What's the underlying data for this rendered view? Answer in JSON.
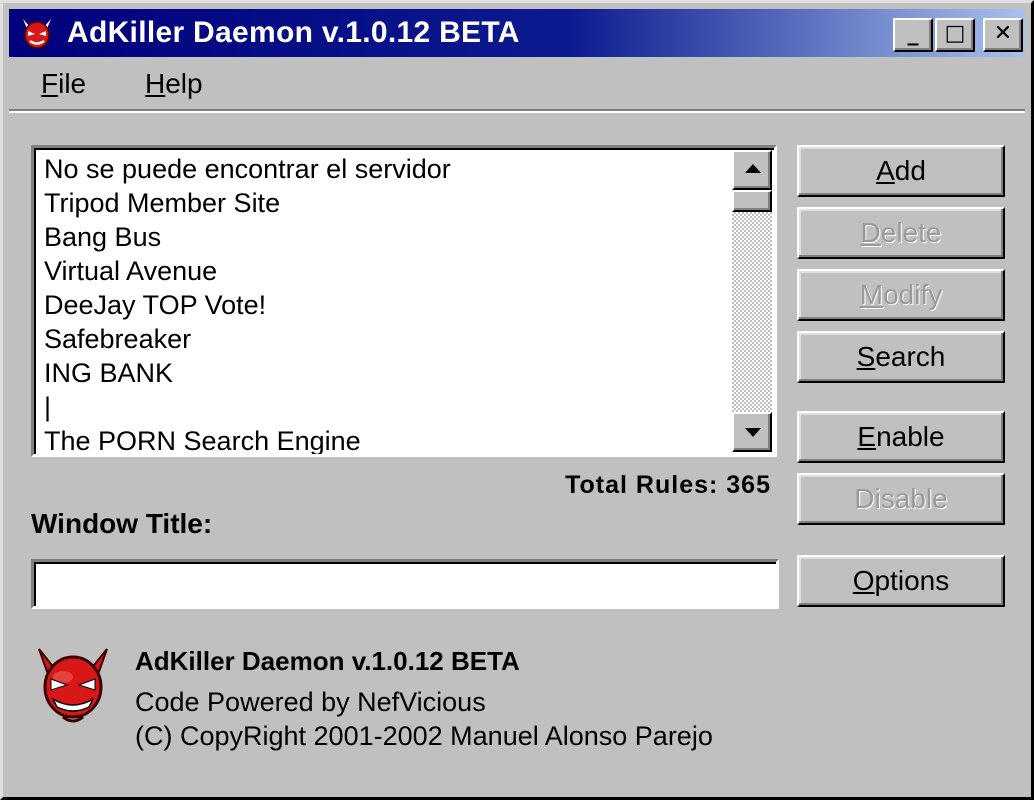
{
  "window": {
    "title": "AdKiller Daemon v.1.0.12 BETA",
    "title_gradient": [
      "#00007b",
      "#a6c2ec"
    ]
  },
  "titlebar_buttons": {
    "minimize": "_",
    "maximize": "□",
    "close": "✕"
  },
  "menu": {
    "file": {
      "accel": "F",
      "rest": "ile"
    },
    "help": {
      "accel": "H",
      "rest": "elp"
    }
  },
  "rules_list": {
    "items": [
      "No se puede encontrar el servidor",
      "Tripod Member Site",
      "Bang Bus",
      "Virtual Avenue",
      "DeeJay TOP Vote!",
      "Safebreaker",
      "ING BANK",
      "|",
      "The PORN Search Engine"
    ]
  },
  "total_rules": "Total Rules: 365",
  "window_title_label": "Window Title:",
  "window_title_value": "",
  "buttons": {
    "add": {
      "accel": "A",
      "rest": "dd",
      "enabled": true
    },
    "delete": {
      "accel": "D",
      "rest": "elete",
      "enabled": false
    },
    "modify": {
      "accel": "M",
      "rest": "odify",
      "enabled": false
    },
    "search": {
      "accel": "S",
      "rest": "earch",
      "enabled": true
    },
    "enable": {
      "accel": "E",
      "rest": "nable",
      "enabled": true
    },
    "disable_label": "Disable",
    "disable_enabled": false,
    "options": {
      "accel": "O",
      "rest": "ptions",
      "enabled": true
    }
  },
  "about": {
    "title": "AdKiller Daemon v.1.0.12 BETA",
    "powered": "Code Powered by NefVicious",
    "copyright": "(C) CopyRight 2001-2002 Manuel Alonso Parejo"
  },
  "icons": {
    "app": "red-devil-icon",
    "logo": "red-devil-logo"
  },
  "colors": {
    "face": "#c0c0c0",
    "disabled_text": "#9a9a9a",
    "devil_red": "#d81818"
  }
}
